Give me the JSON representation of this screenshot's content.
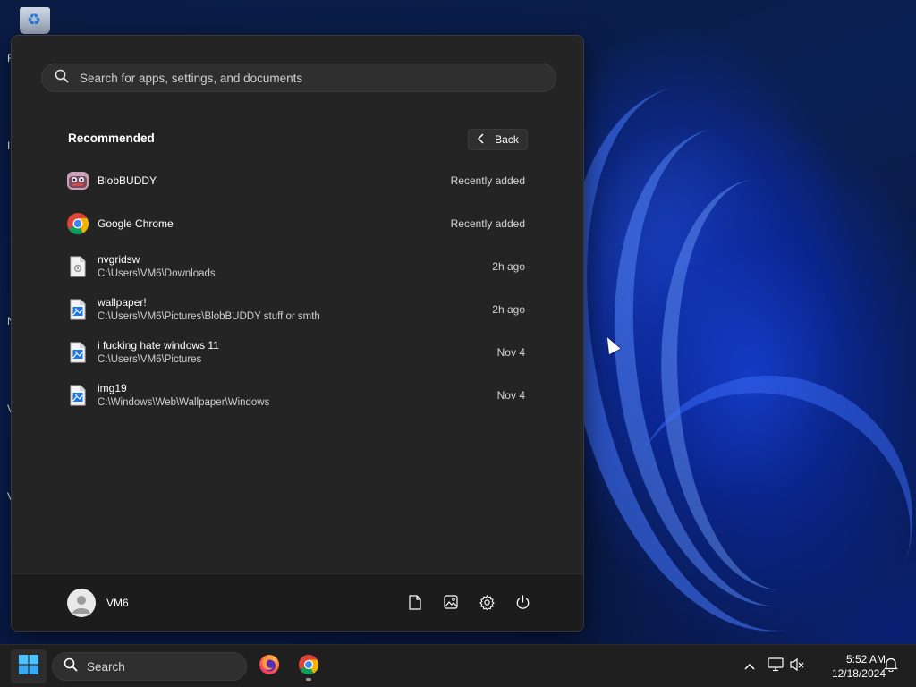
{
  "desktop": {
    "wallpaper": "windows-11-bloom-dark",
    "accent_color": "#2f6bff",
    "icon_fragment_letters": [
      "R",
      "I",
      "N",
      "V",
      "V"
    ]
  },
  "start_menu": {
    "search": {
      "placeholder": "Search for apps, settings, and documents",
      "icon": "search-icon"
    },
    "recommended": {
      "title": "Recommended",
      "back_label": "Back",
      "items": [
        {
          "name": "BlobBUDDY",
          "path": "",
          "time": "Recently added",
          "icon": "blobbuddy-app-icon"
        },
        {
          "name": "Google Chrome",
          "path": "",
          "time": "Recently added",
          "icon": "chrome-icon"
        },
        {
          "name": "nvgridsw",
          "path": "C:\\Users\\VM6\\Downloads",
          "time": "2h ago",
          "icon": "settings-file-icon"
        },
        {
          "name": "wallpaper!",
          "path": "C:\\Users\\VM6\\Pictures\\BlobBUDDY stuff or smth",
          "time": "2h ago",
          "icon": "image-file-icon"
        },
        {
          "name": "i fucking hate windows 11",
          "path": "C:\\Users\\VM6\\Pictures",
          "time": "Nov 4",
          "icon": "image-file-icon"
        },
        {
          "name": "img19",
          "path": "C:\\Windows\\Web\\Wallpaper\\Windows",
          "time": "Nov 4",
          "icon": "image-file-icon"
        }
      ]
    },
    "footer": {
      "user_name": "VM6",
      "icons": [
        "documents-icon",
        "pictures-icon",
        "settings-icon",
        "power-icon"
      ]
    }
  },
  "taskbar": {
    "search_label": "Search",
    "apps": [
      "firefox-icon",
      "chrome-icon"
    ],
    "clock_time": "5:52 AM",
    "clock_date": "12/18/2024"
  }
}
